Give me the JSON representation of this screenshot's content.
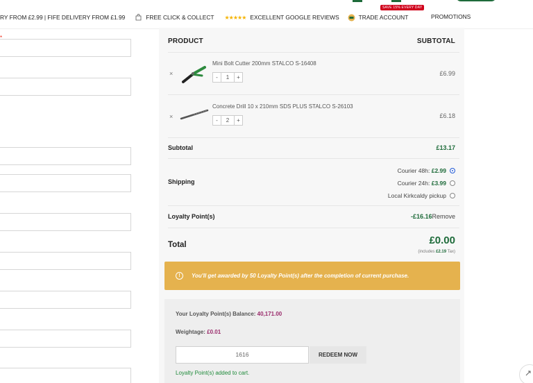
{
  "topbar": {
    "delivery": "RY FROM £2.99 | FIFE DELIVERY FROM £1.99",
    "click_collect": "FREE CLICK & COLLECT",
    "reviews": "EXCELLENT GOOGLE REVIEWS",
    "trade": "TRADE ACCOUNT",
    "trade_badge": "SAVE 15% EVERY DAY",
    "promotions": "PROMOTIONS"
  },
  "order": {
    "col_product": "PRODUCT",
    "col_subtotal": "SUBTOTAL",
    "items": [
      {
        "name": "Mini Bolt Cutter 200mm STALCO S-16408",
        "qty": "1",
        "price": "£6.99"
      },
      {
        "name": "Concrete Drill 10 x 210mm SDS PLUS STALCO S-26103",
        "qty": "2",
        "price": "£6.18"
      }
    ],
    "subtotal_label": "Subtotal",
    "subtotal_value": "£13.17",
    "shipping_label": "Shipping",
    "shipping_options": [
      {
        "label": "Courier 48h: ",
        "price": "£2.99",
        "selected": true
      },
      {
        "label": "Courier 24h: ",
        "price": "£3.99",
        "selected": false
      },
      {
        "label": "Local Kirkcaldy pickup",
        "price": "",
        "selected": false
      }
    ],
    "loyalty_label": "Loyalty Point(s)",
    "loyalty_value": "-£16.16",
    "loyalty_remove": "Remove",
    "total_label": "Total",
    "total_value": "£0.00",
    "tax_prefix": "(includes ",
    "tax_value": "£2.19",
    "tax_suffix": " Tax)"
  },
  "notice": {
    "text": "You'll get awarded by 50 Loyalty Point(s) after the completion of current purchase."
  },
  "loyalty": {
    "balance_label": "Your Loyalty Point(s) Balance: ",
    "balance_value": "40,171.00",
    "weightage_label": "Weightage: ",
    "weightage_value": "£0.01",
    "input_value": "1616",
    "redeem_button": "REDEEM NOW",
    "added_message": "Loyalty Point(s) added to cart."
  }
}
